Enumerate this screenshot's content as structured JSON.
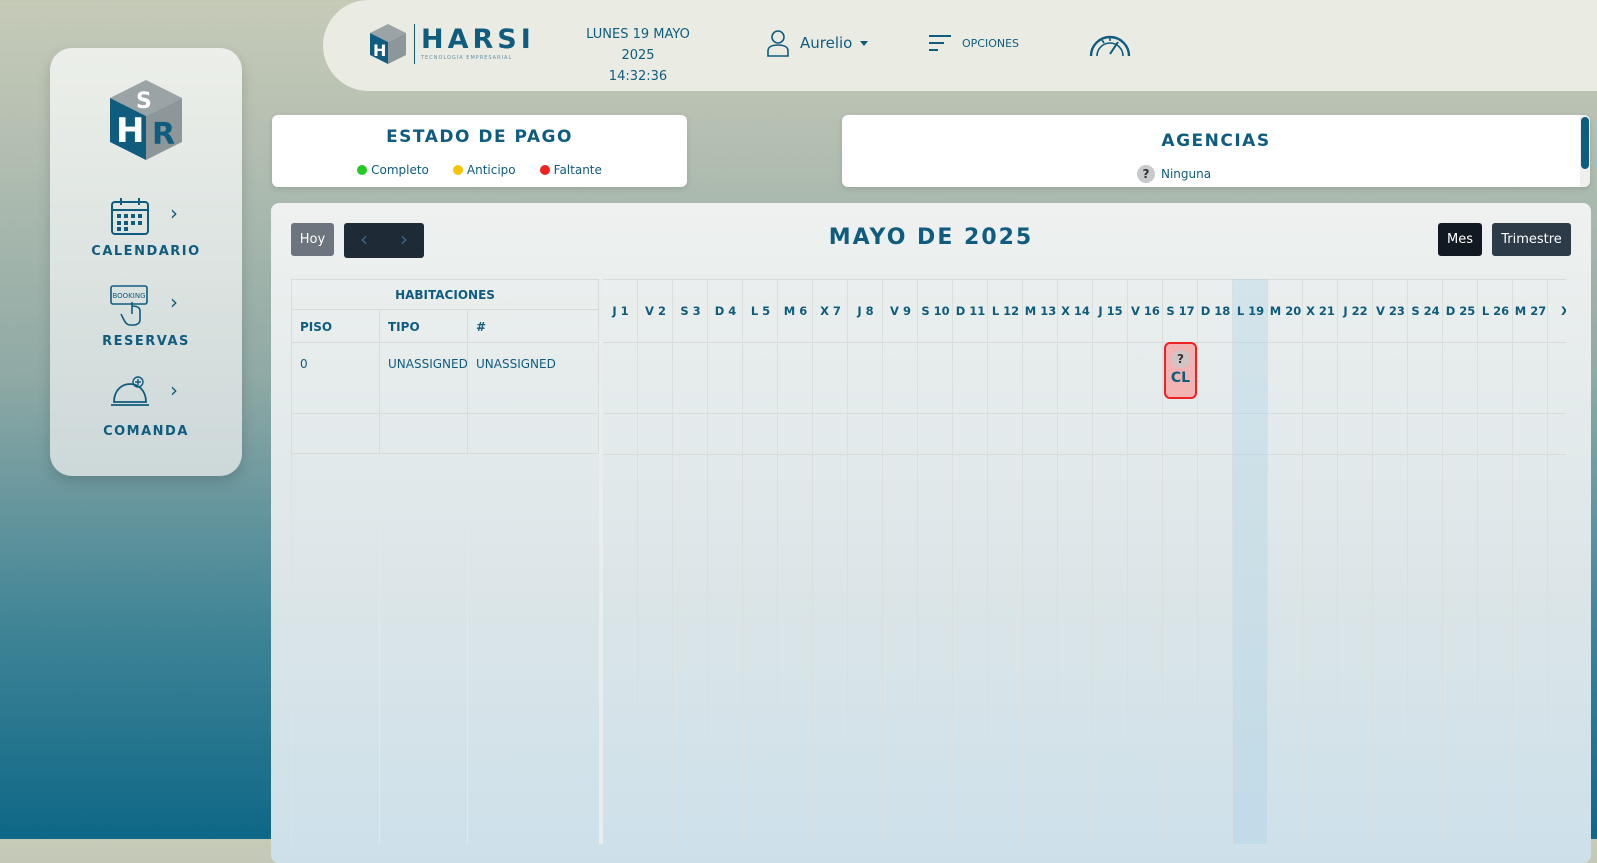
{
  "sidebar": {
    "items": [
      {
        "label": "CALENDARIO",
        "icon": "calendar-icon"
      },
      {
        "label": "RESERVAS",
        "icon": "booking-hand-icon",
        "icon_text": "BOOKING"
      },
      {
        "label": "COMANDA",
        "icon": "room-service-bell-icon"
      }
    ]
  },
  "topbar": {
    "brand": "HARSI",
    "brand_sub": "TECNOLOGÍA EMPRESARIAL",
    "date": "LUNES 19 MAYO 2025",
    "time": "14:32:36",
    "user": "Aurelio",
    "options_label": "OPCIONES"
  },
  "payment_card": {
    "title": "ESTADO DE PAGO",
    "legend": [
      {
        "label": "Completo",
        "color": "#22cc22"
      },
      {
        "label": "Anticipo",
        "color": "#f5c400"
      },
      {
        "label": "Faltante",
        "color": "#ee2222"
      }
    ]
  },
  "agencies_card": {
    "title": "AGENCIAS",
    "items": [
      {
        "label": "Ninguna",
        "icon": "question-icon"
      }
    ]
  },
  "calendar": {
    "today_label": "Hoy",
    "month_title": "MAYO DE 2025",
    "view_month": "Mes",
    "view_quarter": "Trimestre",
    "rooms_header": "HABITACIONES",
    "columns": [
      "PISO",
      "TIPO",
      "#"
    ],
    "rows": [
      {
        "piso": "0",
        "tipo": "UNASSIGNED",
        "numero": "UNASSIGNED"
      }
    ],
    "days": [
      "J 1",
      "V 2",
      "S 3",
      "D 4",
      "L 5",
      "M 6",
      "X 7",
      "J 8",
      "V 9",
      "S 10",
      "D 11",
      "L 12",
      "M 13",
      "X 14",
      "J 15",
      "V 16",
      "S 17",
      "D 18",
      "L 19",
      "M 20",
      "X 21",
      "J 22",
      "V 23",
      "S 24",
      "D 25",
      "L 26",
      "M 27",
      "X"
    ],
    "today_index": 18,
    "reservation": {
      "day_index": 16,
      "symbol": "?",
      "text": "CL",
      "status_color": "#ee2222"
    }
  },
  "colors": {
    "accent": "#0f5c7e",
    "dark_button": "#1e2a36"
  }
}
